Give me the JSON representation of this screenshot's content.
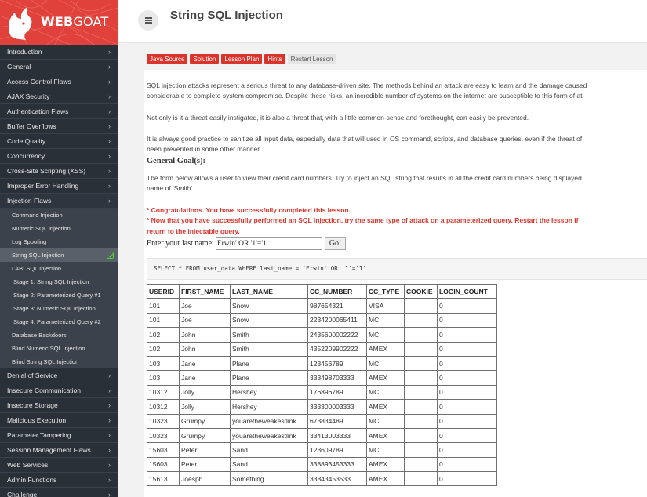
{
  "brand": {
    "name_bold": "WEB",
    "name_rest": "GOAT"
  },
  "header": {
    "title": "String SQL Injection"
  },
  "nav": {
    "items_top": [
      "Introduction",
      "General",
      "Access Control Flaws",
      "AJAX Security",
      "Authentication Flaws",
      "Buffer Overflows",
      "Code Quality",
      "Concurrency",
      "Cross-Site Scripting (XSS)",
      "Improper Error Handling"
    ],
    "open_item": "Injection Flaws",
    "sub_items": [
      {
        "label": "Command Injection",
        "stage": false,
        "active": false
      },
      {
        "label": "Numeric SQL Injection",
        "stage": false,
        "active": false
      },
      {
        "label": "Log Spoofing",
        "stage": false,
        "active": false
      },
      {
        "label": "String SQL Injection",
        "stage": false,
        "active": true
      },
      {
        "label": "LAB: SQL Injection",
        "stage": false,
        "active": false
      },
      {
        "label": "Stage 1: String SQL Injection",
        "stage": true,
        "active": false
      },
      {
        "label": "Stage 2: Parameterized Query #1",
        "stage": true,
        "active": false
      },
      {
        "label": "Stage 3: Numeric SQL Injection",
        "stage": true,
        "active": false
      },
      {
        "label": "Stage 4: Parameterized Query #2",
        "stage": true,
        "active": false
      },
      {
        "label": "Database Backdoors",
        "stage": false,
        "active": false
      },
      {
        "label": "Blind Numeric SQL Injection",
        "stage": false,
        "active": false
      },
      {
        "label": "Blind String SQL Injection",
        "stage": false,
        "active": false
      }
    ],
    "items_bottom": [
      "Denial of Service",
      "Insecure Communication",
      "Insecure Storage",
      "Malicious Execution",
      "Parameter Tampering",
      "Session Management Flaws",
      "Web Services",
      "Admin Functions",
      "Challenge"
    ]
  },
  "toolbar": {
    "java_source": "Java Source",
    "solution": "Solution",
    "lesson_plan": "Lesson Plan",
    "hints": "Hints",
    "restart": "Restart Lesson"
  },
  "content": {
    "p1_line1": "SQL injection attacks represent a serious threat to any database-driven site. The methods behind an attack are easy to learn and the damage caused",
    "p1_line2": "considerable to complete system compromise. Despite these risks, an incredible number of systems on the internet are susceptible to this form of at",
    "p2": "Not only is it a threat easily instigated, it is also a threat that, with a little common-sense and forethought, can easily be prevented.",
    "p3_line1": "It is always good practice to sanitize all input data, especially data that will used in OS command, scripts, and database queries, even if the threat of",
    "p3_line2": "been prevented in some other manner.",
    "goal_heading": "General Goal(s):",
    "goal_line1": "The form below allows a user to view their credit card numbers. Try to inject an SQL string that results in all the credit card numbers being displayed",
    "goal_line2": "name of 'Smith'.",
    "feedback1": "* Congratulations. You have successfully completed this lesson.",
    "feedback2_line1": "* Now that you have successfully performed an SQL injection, try the same type of attack on a parameterized query. Restart the lesson if",
    "feedback2_line2": "return to the injectable query.",
    "form_label": "Enter your last name:",
    "form_value": "Erwin' OR '1'='1",
    "go_label": "Go!",
    "sql_query": "SELECT * FROM user_data WHERE last_name = 'Erwin' OR '1'='1'"
  },
  "table": {
    "headers": [
      "USERID",
      "FIRST_NAME",
      "LAST_NAME",
      "CC_NUMBER",
      "CC_TYPE",
      "COOKIE",
      "LOGIN_COUNT"
    ],
    "rows": [
      [
        "101",
        "Joe",
        "Snow",
        "987654321",
        "VISA",
        "",
        "0"
      ],
      [
        "101",
        "Joe",
        "Snow",
        "2234200065411",
        "MC",
        "",
        "0"
      ],
      [
        "102",
        "John",
        "Smith",
        "2435600002222",
        "MC",
        "",
        "0"
      ],
      [
        "102",
        "John",
        "Smith",
        "4352209902222",
        "AMEX",
        "",
        "0"
      ],
      [
        "103",
        "Jane",
        "Plane",
        "123456789",
        "MC",
        "",
        "0"
      ],
      [
        "103",
        "Jane",
        "Plane",
        "333498703333",
        "AMEX",
        "",
        "0"
      ],
      [
        "10312",
        "Jolly",
        "Hershey",
        "176896789",
        "MC",
        "",
        "0"
      ],
      [
        "10312",
        "Jolly",
        "Hershey",
        "333300003333",
        "AMEX",
        "",
        "0"
      ],
      [
        "10323",
        "Grumpy",
        "youaretheweakestlink",
        "673834489",
        "MC",
        "",
        "0"
      ],
      [
        "10323",
        "Grumpy",
        "youaretheweakestlink",
        "33413003333",
        "AMEX",
        "",
        "0"
      ],
      [
        "15603",
        "Peter",
        "Sand",
        "123609789",
        "MC",
        "",
        "0"
      ],
      [
        "15603",
        "Peter",
        "Sand",
        "338893453333",
        "AMEX",
        "",
        "0"
      ],
      [
        "15613",
        "Joesph",
        "Something",
        "33843453533",
        "AMEX",
        "",
        "0"
      ]
    ]
  }
}
